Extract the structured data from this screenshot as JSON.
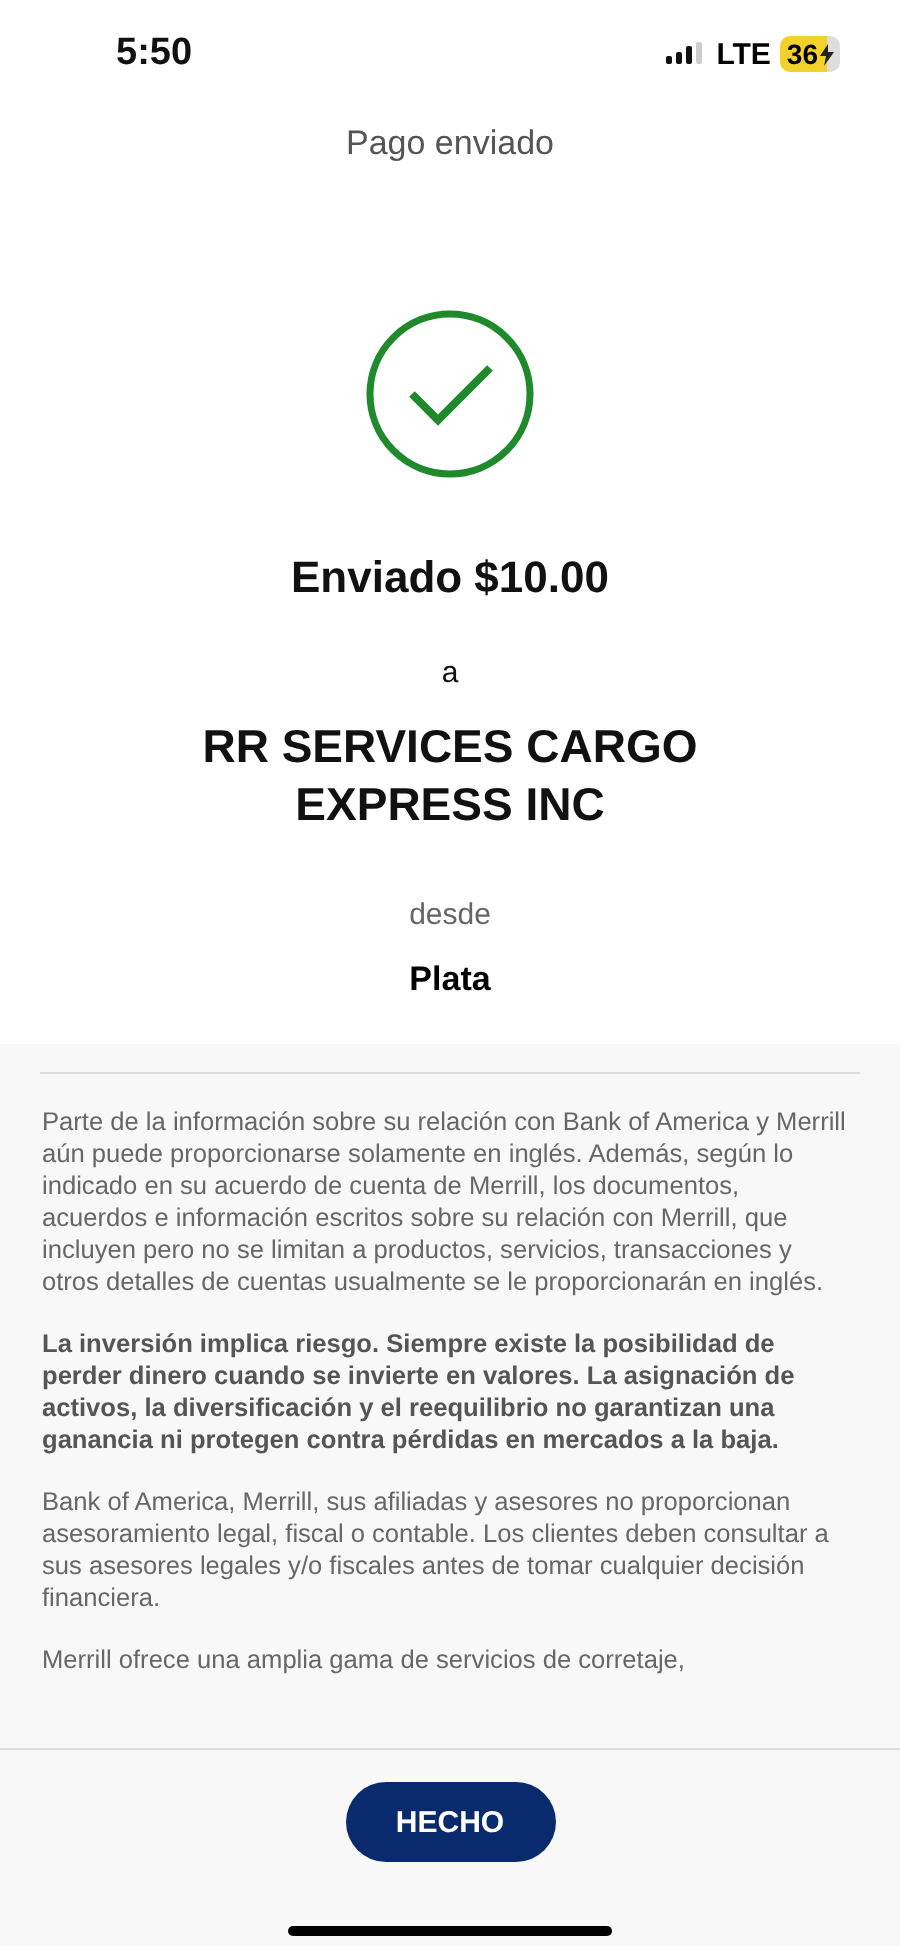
{
  "status_bar": {
    "time": "5:50",
    "network": "LTE",
    "battery": "36"
  },
  "header": {
    "title": "Pago enviado"
  },
  "confirmation": {
    "amount": "Enviado $10.00",
    "to_label": "a",
    "recipient": "RR SERVICES CARGO EXPRESS INC",
    "from_label": "desde",
    "account": "Plata"
  },
  "disclosures": [
    {
      "bold": false,
      "text": "Parte de la información sobre su relación con Bank of America y Merrill aún puede proporcionarse solamente en inglés. Además, según lo indicado en su acuerdo de cuenta de Merrill, los documentos, acuerdos e información escritos sobre su relación con Merrill, que incluyen pero no se limitan a productos, servicios, transacciones y otros detalles de cuentas usualmente se le proporcionarán en inglés."
    },
    {
      "bold": true,
      "text": "La inversión implica riesgo. Siempre existe la posibilidad de perder dinero cuando se invierte en valores. La asignación de activos, la diversificación y el reequilibrio no garantizan una ganancia ni protegen contra pérdidas en mercados a la baja."
    },
    {
      "bold": false,
      "text": "Bank of America, Merrill, sus afiliadas y asesores no proporcionan asesoramiento legal, fiscal o contable. Los clientes deben consultar a sus asesores legales y/o fiscales antes de tomar cualquier decisión financiera."
    },
    {
      "bold": false,
      "text": "Merrill ofrece una amplia gama de servicios de corretaje,"
    }
  ],
  "done_button": "HECHO"
}
